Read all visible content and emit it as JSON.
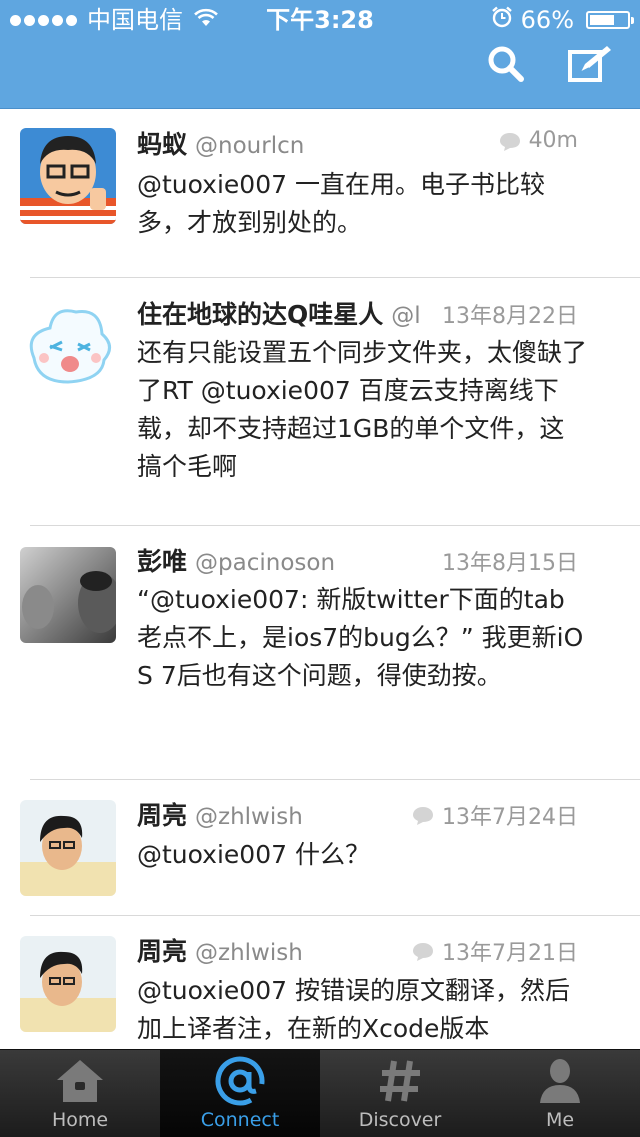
{
  "status_bar": {
    "carrier": "中国电信",
    "time": "下午3:28",
    "battery": "66%",
    "battery_level": 0.66,
    "icons": [
      "signal-dots-icon",
      "wifi-icon",
      "alarm-icon",
      "battery-icon"
    ]
  },
  "nav": {
    "actions": [
      {
        "name": "search",
        "icon": "search-icon"
      },
      {
        "name": "compose",
        "icon": "compose-icon"
      }
    ]
  },
  "tweets": [
    {
      "name": "蚂蚁",
      "handle": "@nourlcn",
      "time": "40m",
      "reply_icon": true,
      "text": "@tuoxie007 一直在用。电子书比较多，才放到别处的。"
    },
    {
      "name": "住在地球的达Q哇星人",
      "handle": "@l",
      "time": "13年8月22日",
      "reply_icon": false,
      "text": "还有只能设置五个同步文件夹，太傻缺了了RT @tuoxie007 百度云支持离线下载，却不支持超过1GB的单个文件，这搞个毛啊"
    },
    {
      "name": "彭唯",
      "handle": "@pacinoson",
      "time": "13年8月15日",
      "reply_icon": false,
      "text": "“@tuoxie007: 新版twitter下面的tab老点不上，是ios7的bug么？” 我更新iOS 7后也有这个问题，得使劲按。"
    },
    {
      "name": "周亮",
      "handle": "@zhlwish",
      "time": "13年7月24日",
      "reply_icon": true,
      "text": "@tuoxie007 什么？"
    },
    {
      "name": "周亮",
      "handle": "@zhlwish",
      "time": "13年7月21日",
      "reply_icon": true,
      "text": "@tuoxie007 按错误的原文翻译，然后加上译者注，在新的Xcode版本"
    }
  ],
  "tabs": [
    {
      "label": "Home",
      "icon": "home-icon",
      "active": false
    },
    {
      "label": "Connect",
      "icon": "at-sign-icon",
      "active": true
    },
    {
      "label": "Discover",
      "icon": "hashtag-icon",
      "active": false
    },
    {
      "label": "Me",
      "icon": "person-icon",
      "active": false
    }
  ],
  "colors": {
    "header": "#5fa6e0",
    "active_tab": "#3a9fe8",
    "text": "#222222",
    "muted": "#8a8a8a"
  }
}
